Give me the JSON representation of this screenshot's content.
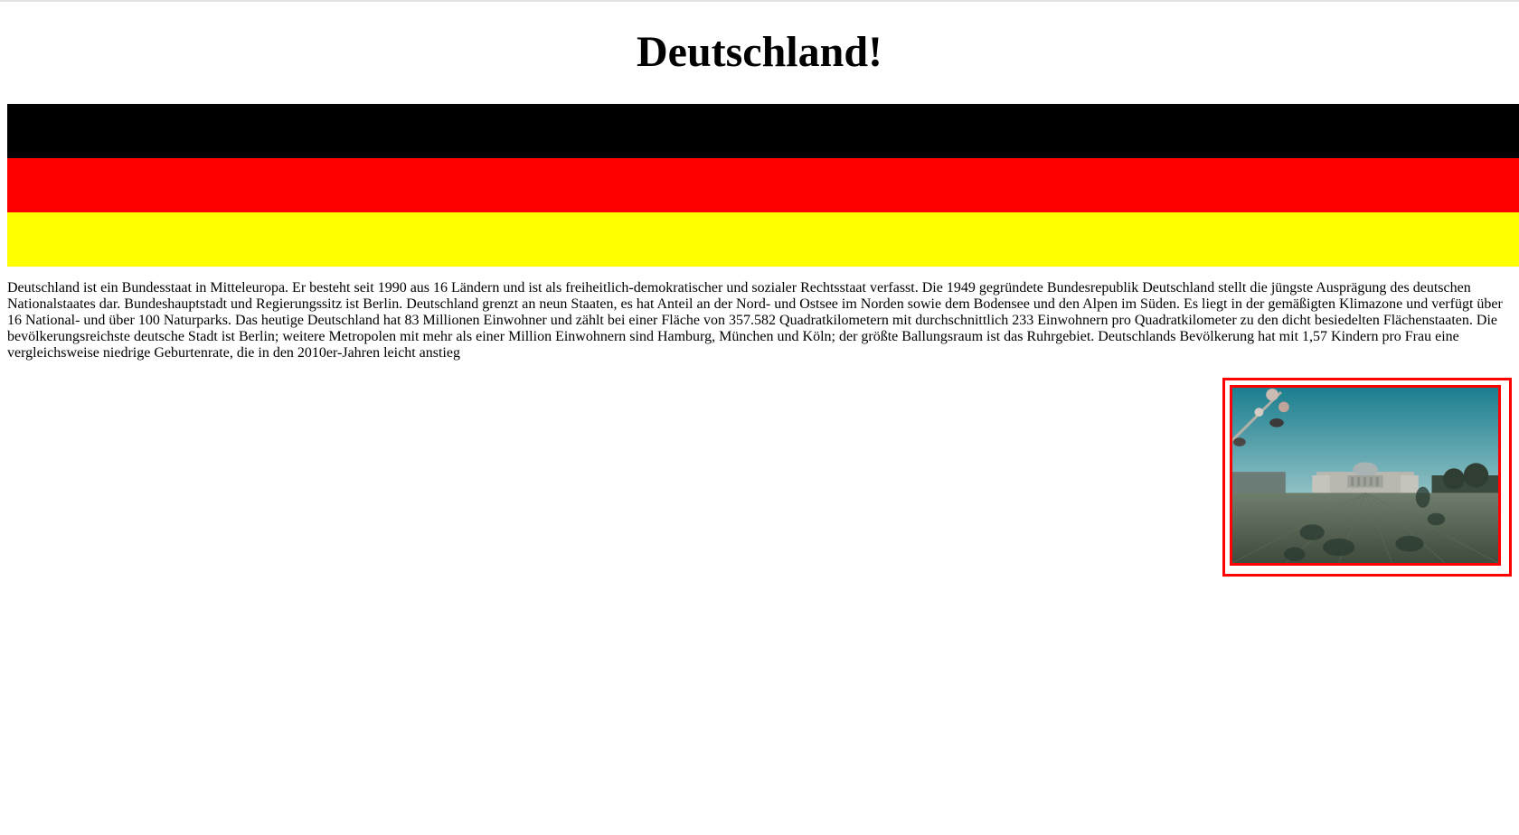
{
  "page": {
    "title": "Deutschland!"
  },
  "flag": {
    "colors": [
      "#000000",
      "#ff0000",
      "#ffff00"
    ]
  },
  "intro": {
    "text": "Deutschland ist ein Bundesstaat in Mitteleuropa. Er besteht seit 1990 aus 16 Ländern und ist als freiheitlich-demokratischer und sozialer Rechtsstaat verfasst. Die 1949 gegründete Bundesrepublik Deutschland stellt die jüngste Ausprägung des deutschen Nationalstaates dar. Bundeshauptstadt und Regierungssitz ist Berlin. Deutschland grenzt an neun Staaten, es hat Anteil an der Nord- und Ostsee im Norden sowie dem Bodensee und den Alpen im Süden. Es liegt in der gemäßigten Klimazone und verfügt über 16 National- und über 100 Naturparks. Das heutige Deutschland hat 83 Millionen Einwohner und zählt bei einer Fläche von 357.582 Quadratkilometern mit durchschnittlich 233 Einwohnern pro Quadratkilometer zu den dicht besiedelten Flächenstaaten. Die bevölkerungsreichste deutsche Stadt ist Berlin; weitere Metropolen mit mehr als einer Million Einwohnern sind Hamburg, München und Köln; der größte Ballungsraum ist das Ruhrgebiet. Deutschlands Bevölkerung hat mit 1,57 Kindern pro Frau eine vergleichsweise niedrige Geburtenrate, die in den 2010er-Jahren leicht anstieg"
  },
  "photo": {
    "border_color": "#ff0000"
  }
}
